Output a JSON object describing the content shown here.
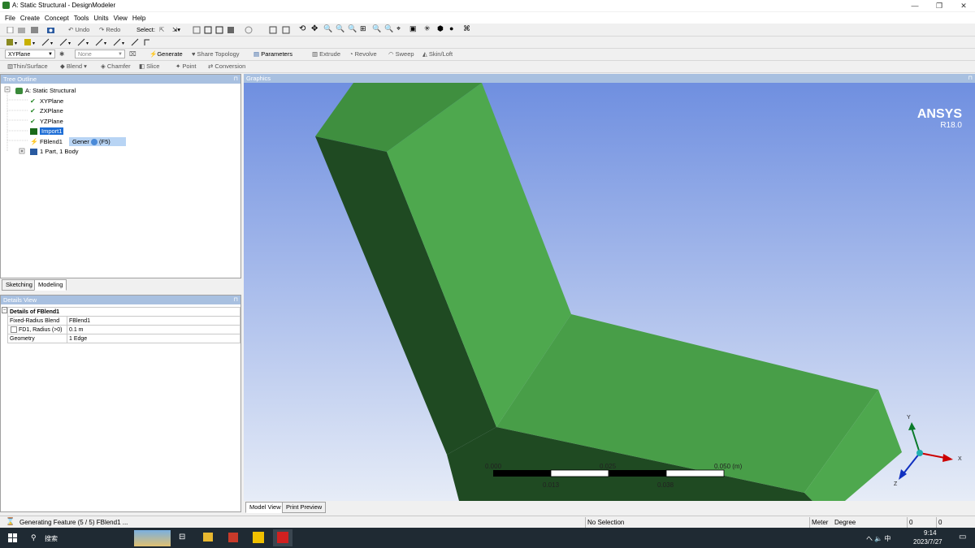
{
  "window": {
    "title": "A: Static Structural - DesignModeler"
  },
  "menu": [
    "File",
    "Create",
    "Concept",
    "Tools",
    "Units",
    "View",
    "Help"
  ],
  "toolbar1": {
    "undo": "Undo",
    "redo": "Redo",
    "select": "Select:"
  },
  "toolbar3": {
    "plane": "XYPlane",
    "sketch": "None",
    "generate": "Generate",
    "share_topology": "Share Topology",
    "parameters": "Parameters",
    "extrude": "Extrude",
    "revolve": "Revolve",
    "sweep": "Sweep",
    "skin_loft": "Skin/Loft"
  },
  "toolbar4": {
    "thin_surface": "Thin/Surface",
    "blend": "Blend",
    "chamfer": "Chamfer",
    "slice": "Slice",
    "point": "Point",
    "conversion": "Conversion"
  },
  "tree": {
    "header": "Tree Outline",
    "root": "A: Static Structural",
    "items": [
      "XYPlane",
      "ZXPlane",
      "YZPlane",
      "Import1",
      "FBlend1",
      "1 Part, 1 Body"
    ],
    "tooltip": "Gener",
    "tooltip_suffix": "(F5)"
  },
  "tabs_left": [
    "Sketching",
    "Modeling"
  ],
  "details": {
    "header": "Details View",
    "title": "Details of FBlend1",
    "rows": [
      [
        "Fixed-Radius Blend",
        "FBlend1"
      ],
      [
        "FD1, Radius (>0)",
        "0.1 m"
      ],
      [
        "Geometry",
        "1 Edge"
      ]
    ]
  },
  "graphics": {
    "header": "Graphics",
    "brand": "ANSYS",
    "version": "R18.0",
    "scale_top": [
      "0.000",
      "0.025",
      "0.050 (m)"
    ],
    "scale_bottom": [
      "0.013",
      "0.038"
    ],
    "axes": {
      "x": "X",
      "y": "Y",
      "z": "Z"
    },
    "colors": {
      "bg_top": "#6f8fe0",
      "bg_bottom": "#e6ecf7",
      "solid_light": "#4ea84e",
      "solid_dark": "#1f4a22"
    }
  },
  "tabs_graphics": [
    "Model View",
    "Print Preview"
  ],
  "status": {
    "message": "Generating Feature (5 / 5) FBlend1 ...",
    "selection": "No Selection",
    "unit": "Meter",
    "angle": "Degree",
    "v1": "0",
    "v2": "0"
  },
  "taskbar": {
    "search": "搜索",
    "time": "9:14",
    "date": "2023/7/27",
    "tray": "へ 🔈 中"
  }
}
